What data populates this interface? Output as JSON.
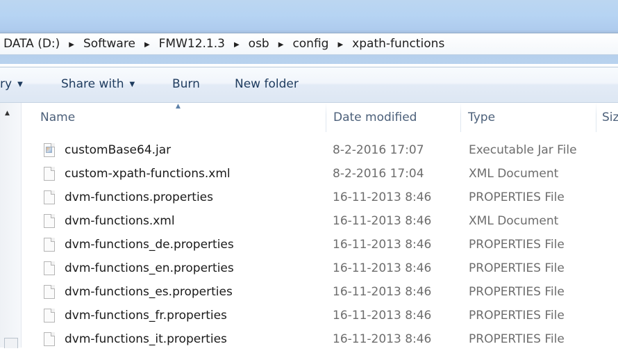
{
  "window": {
    "breadcrumb": [
      "DATA (D:)",
      "Software",
      "FMW12.1.3",
      "osb",
      "config",
      "xpath-functions"
    ]
  },
  "toolbar": {
    "library_label": "ry",
    "share_with_label": "Share with",
    "burn_label": "Burn",
    "new_folder_label": "New folder"
  },
  "columns": {
    "name": "Name",
    "date": "Date modified",
    "type": "Type",
    "size": "Siz"
  },
  "files": [
    {
      "name": "customBase64.jar",
      "date": "8-2-2016 17:07",
      "type": "Executable Jar File",
      "icon": "jar-file-icon"
    },
    {
      "name": "custom-xpath-functions.xml",
      "date": "8-2-2016 17:04",
      "type": "XML Document",
      "icon": "file-icon"
    },
    {
      "name": "dvm-functions.properties",
      "date": "16-11-2013 8:46",
      "type": "PROPERTIES File",
      "icon": "file-icon"
    },
    {
      "name": "dvm-functions.xml",
      "date": "16-11-2013 8:46",
      "type": "XML Document",
      "icon": "file-icon"
    },
    {
      "name": "dvm-functions_de.properties",
      "date": "16-11-2013 8:46",
      "type": "PROPERTIES File",
      "icon": "file-icon"
    },
    {
      "name": "dvm-functions_en.properties",
      "date": "16-11-2013 8:46",
      "type": "PROPERTIES File",
      "icon": "file-icon"
    },
    {
      "name": "dvm-functions_es.properties",
      "date": "16-11-2013 8:46",
      "type": "PROPERTIES File",
      "icon": "file-icon"
    },
    {
      "name": "dvm-functions_fr.properties",
      "date": "16-11-2013 8:46",
      "type": "PROPERTIES File",
      "icon": "file-icon"
    },
    {
      "name": "dvm-functions_it.properties",
      "date": "16-11-2013 8:46",
      "type": "PROPERTIES File",
      "icon": "file-icon"
    }
  ],
  "icons": {
    "breadcrumb_separator": "▶",
    "dropdown_caret": "▼",
    "sort_ascending": "▲",
    "scroll_up": "▲"
  }
}
